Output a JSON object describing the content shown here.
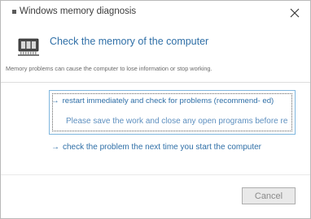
{
  "window": {
    "title": "Windows memory diagnosis"
  },
  "header": {
    "icon": "memory-chip-icon",
    "title": "Check the memory of the computer",
    "warning": "Memory problems can cause the computer to lose information or stop working."
  },
  "options": [
    {
      "arrow": "→",
      "title": "restart immediately and check for problems (recommend- ed)",
      "description": "Please save the work and close any open programs before re"
    },
    {
      "arrow": "→",
      "title": "check the problem the next time you start the computer"
    }
  ],
  "footer": {
    "cancel_label": "Cancel"
  }
}
